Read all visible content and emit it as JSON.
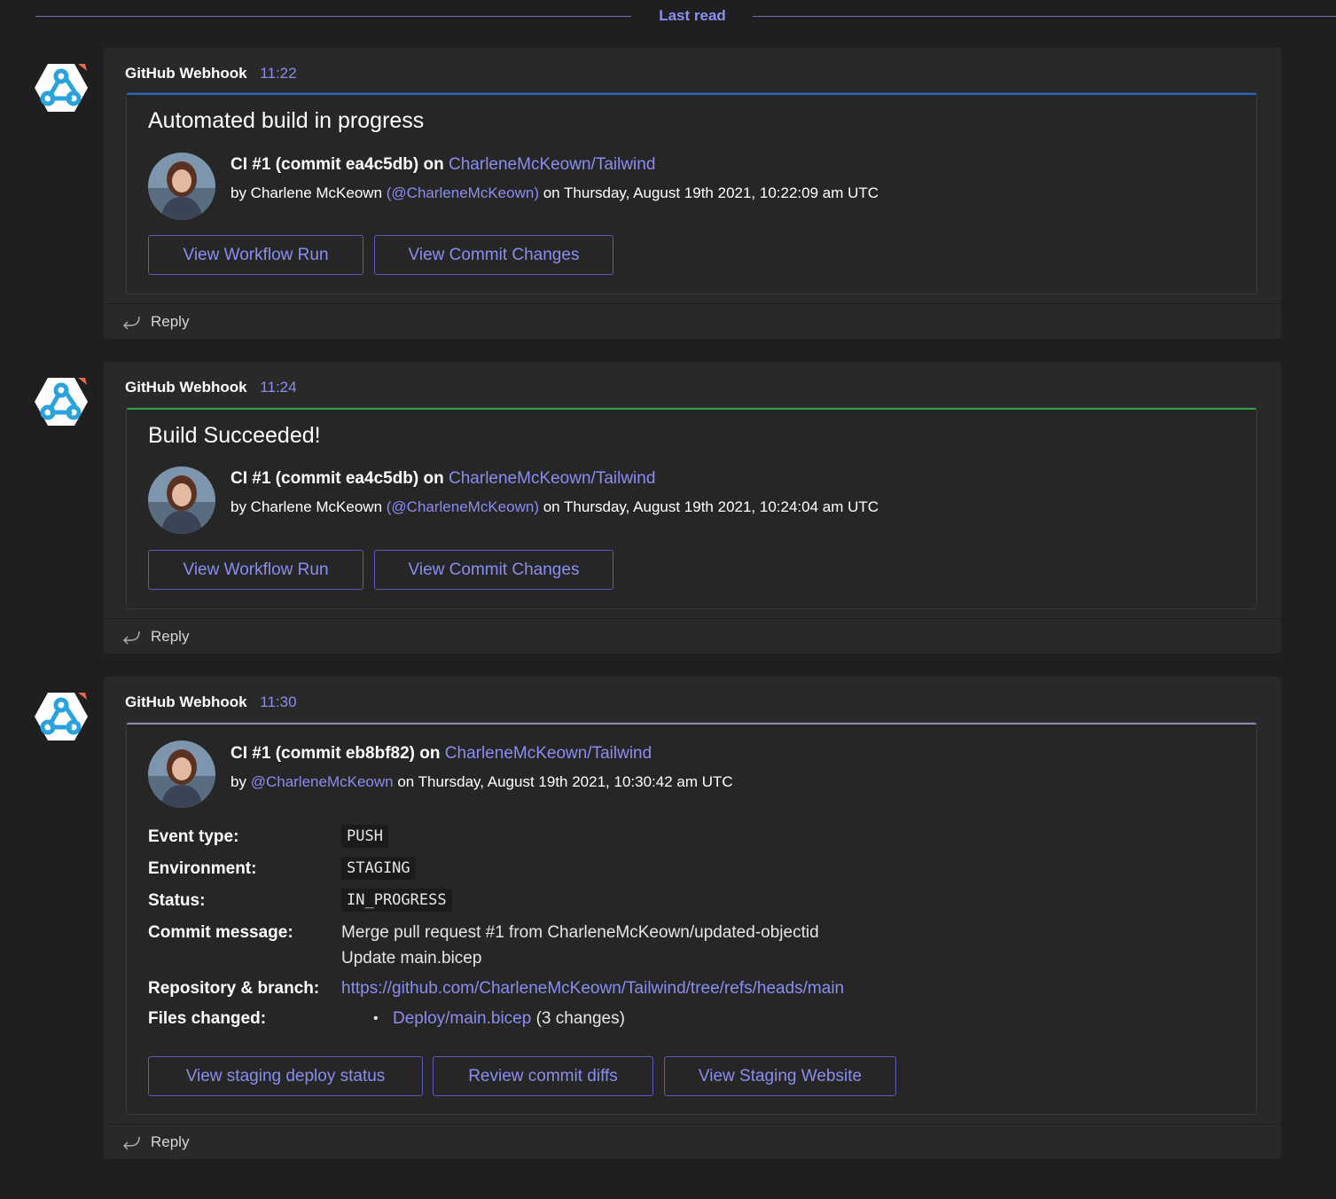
{
  "last_read": "Last read",
  "reply_label": "Reply",
  "colors": {
    "accent_link": "#8b8df0",
    "in_progress_accent": "#1f6bd1",
    "success_accent": "#2ea043",
    "neutral_accent": "#8a8ab0"
  },
  "messages": [
    {
      "sender": "GitHub Webhook",
      "time": "11:22",
      "card": {
        "title": "Automated build in progress",
        "ci_prefix": "CI #1 (commit ea4c5db) on",
        "repo": "CharleneMcKeown/Tailwind",
        "by_prefix": "by Charlene McKeown",
        "handle": "(@CharleneMcKeown)",
        "on_text": "on Thursday, August 19th 2021, 10:22:09 am UTC",
        "buttons": [
          "View Workflow Run",
          "View Commit Changes"
        ]
      }
    },
    {
      "sender": "GitHub Webhook",
      "time": "11:24",
      "card": {
        "title": "Build Succeeded!",
        "ci_prefix": "CI #1 (commit ea4c5db) on",
        "repo": "CharleneMcKeown/Tailwind",
        "by_prefix": "by Charlene McKeown",
        "handle": "(@CharleneMcKeown)",
        "on_text": "on Thursday, August 19th 2021, 10:24:04 am UTC",
        "buttons": [
          "View Workflow Run",
          "View Commit Changes"
        ]
      }
    },
    {
      "sender": "GitHub Webhook",
      "time": "11:30",
      "card": {
        "ci_prefix": "CI #1 (commit eb8bf82) on",
        "repo": "CharleneMcKeown/Tailwind",
        "by_prefix": "by",
        "handle": "@CharleneMcKeown",
        "on_text": "on Thursday, August 19th 2021, 10:30:42 am UTC",
        "facts": {
          "event_type_label": "Event type:",
          "event_type": "PUSH",
          "environment_label": "Environment:",
          "environment": "STAGING",
          "status_label": "Status:",
          "status": "IN_PROGRESS",
          "commit_message_label": "Commit message:",
          "commit_message_line1": "Merge pull request #1 from CharleneMcKeown/updated-objectid",
          "commit_message_line2": "Update main.bicep",
          "repo_branch_label": "Repository & branch:",
          "repo_branch": "https://github.com/CharleneMcKeown/Tailwind/tree/refs/heads/main",
          "files_changed_label": "Files changed:",
          "file_name": "Deploy/main.bicep",
          "file_changes": "(3 changes)"
        },
        "buttons": [
          "View staging deploy status",
          "Review commit diffs",
          "View Staging Website"
        ]
      }
    }
  ]
}
